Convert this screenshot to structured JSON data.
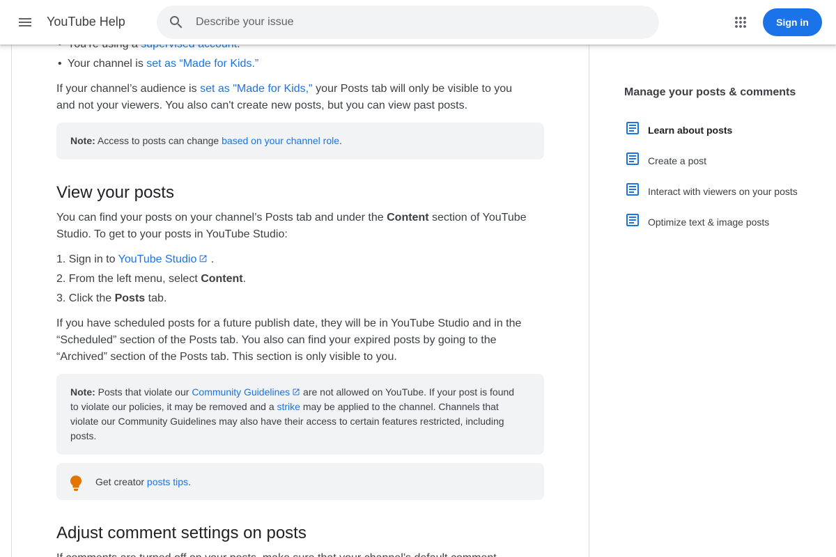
{
  "header": {
    "app_title": "YouTube Help",
    "search_placeholder": "Describe your issue",
    "signin_label": "Sign in"
  },
  "article": {
    "bullets": [
      {
        "prefix": "You’re using a ",
        "link": "supervised account",
        "suffix": "."
      },
      {
        "prefix": "Your channel is ",
        "link": "set as “Made for Kids.”",
        "suffix": ""
      }
    ],
    "para1": {
      "prefix": "If your channel’s audience is ",
      "link": "set as \"Made for Kids,\"",
      "suffix_line1": " your Posts tab will only be visible to you",
      "line2": "and not your viewers. You also can't create new posts, but you can view past posts."
    },
    "note1": {
      "label": "Note:",
      "text": " Access to posts can change ",
      "link": "based on your channel role",
      "suffix": "."
    },
    "h2_view": "View your posts",
    "para2": {
      "line1_prefix": "You can find your posts on your channel’s Posts tab and under the ",
      "bold": "Content",
      "line1_suffix": " section of YouTube",
      "line2": "Studio. To get to your posts in YouTube Studio:"
    },
    "steps": [
      {
        "num": "1.",
        "prefix": "Sign in to ",
        "link": "YouTube Studio",
        "suffix": " ."
      },
      {
        "num": "2.",
        "prefix": "From the left menu, select ",
        "bold": "Content",
        "suffix": "."
      },
      {
        "num": "3.",
        "prefix": "Click the ",
        "bold": "Posts",
        "suffix": " tab."
      }
    ],
    "para3": {
      "line1": "If you have scheduled posts for a future publish date, they will be in YouTube Studio and in the",
      "line2": "“Scheduled” section of the Posts tab. You also can find your expired posts by going to the",
      "line3": "“Archived” section of the Posts tab. This section is only visible to you."
    },
    "note2": {
      "label": "Note:",
      "t1": " Posts that violate our ",
      "link1": "Community Guidelines",
      "t2": "  are not allowed on YouTube. If your post is found",
      "t3": "to violate our policies, it may be removed and a ",
      "link2": "strike",
      "t4": " may be applied to the channel. Channels that",
      "t5": "violate our Community Guidelines may also have their access to certain features restricted, including",
      "t6": "posts."
    },
    "tip": {
      "prefix": "Get creator ",
      "link": "posts tips",
      "suffix": "."
    },
    "h2_adjust": "Adjust comment settings on posts",
    "para4_partial": "If comments are turned off on your posts, make sure that your channel’s default comment"
  },
  "sidebar": {
    "title": "Manage your posts & comments",
    "items": [
      {
        "label": "Learn about posts",
        "active": true
      },
      {
        "label": "Create a post",
        "active": false
      },
      {
        "label": "Interact with viewers on your posts",
        "active": false
      },
      {
        "label": "Optimize text & image posts",
        "active": false
      }
    ]
  },
  "colors": {
    "link": "#1a73e8",
    "note_bg": "#f1f3f4",
    "tip_icon": "#e37400",
    "primary": "#1a73e8"
  },
  "icons": [
    "menu-icon",
    "search-icon",
    "apps-grid-icon",
    "external-link-icon",
    "lightbulb-icon",
    "document-icon"
  ]
}
